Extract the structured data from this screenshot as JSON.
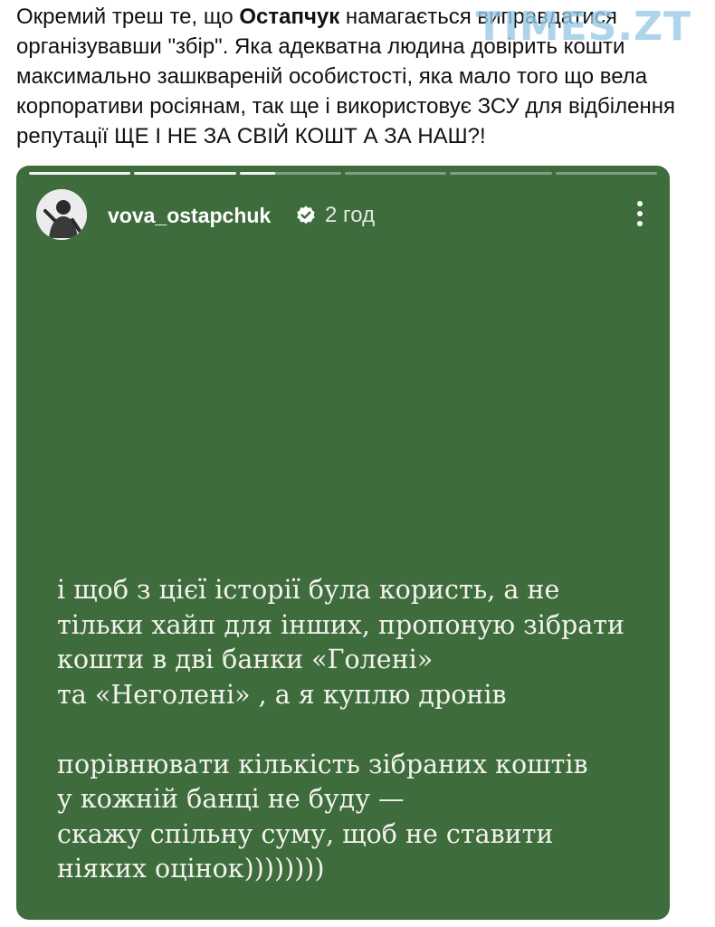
{
  "post": {
    "text_before": "Окремий треш те, що ",
    "name_bold": "Остапчук",
    "text_after": " намагається виправдатися організувавши \"збір\". Яка адекватна людина довірить кошти максимально зашквареній особистості, яка мало того що вела корпоративи росіянам, так ще і використовує ЗСУ для відбілення репутації ЩЕ І НЕ ЗА СВІЙ КОШТ А ЗА НАШ?!"
  },
  "watermark": "TIMES.ZT",
  "story": {
    "username": "vova_ostapchuk",
    "verified_icon": "verified-check-icon",
    "time": "2 год",
    "more_icon": "more-vertical-icon",
    "background_color": "#3e6c3c",
    "progress": [
      1,
      1,
      0.35,
      0,
      0,
      0
    ],
    "lines": [
      "і щоб з цієї історії була користь, а не",
      "тільки хайп для інших, пропоную зібрати",
      "кошти в дві банки «Голені»",
      "та  «Неголені» , а я куплю дронів",
      "",
      "порівнювати кількість зібраних коштів",
      "у кожній банці не буду —",
      "скажу спільну суму, щоб не ставити",
      "ніяких оцінок))))))))"
    ]
  }
}
